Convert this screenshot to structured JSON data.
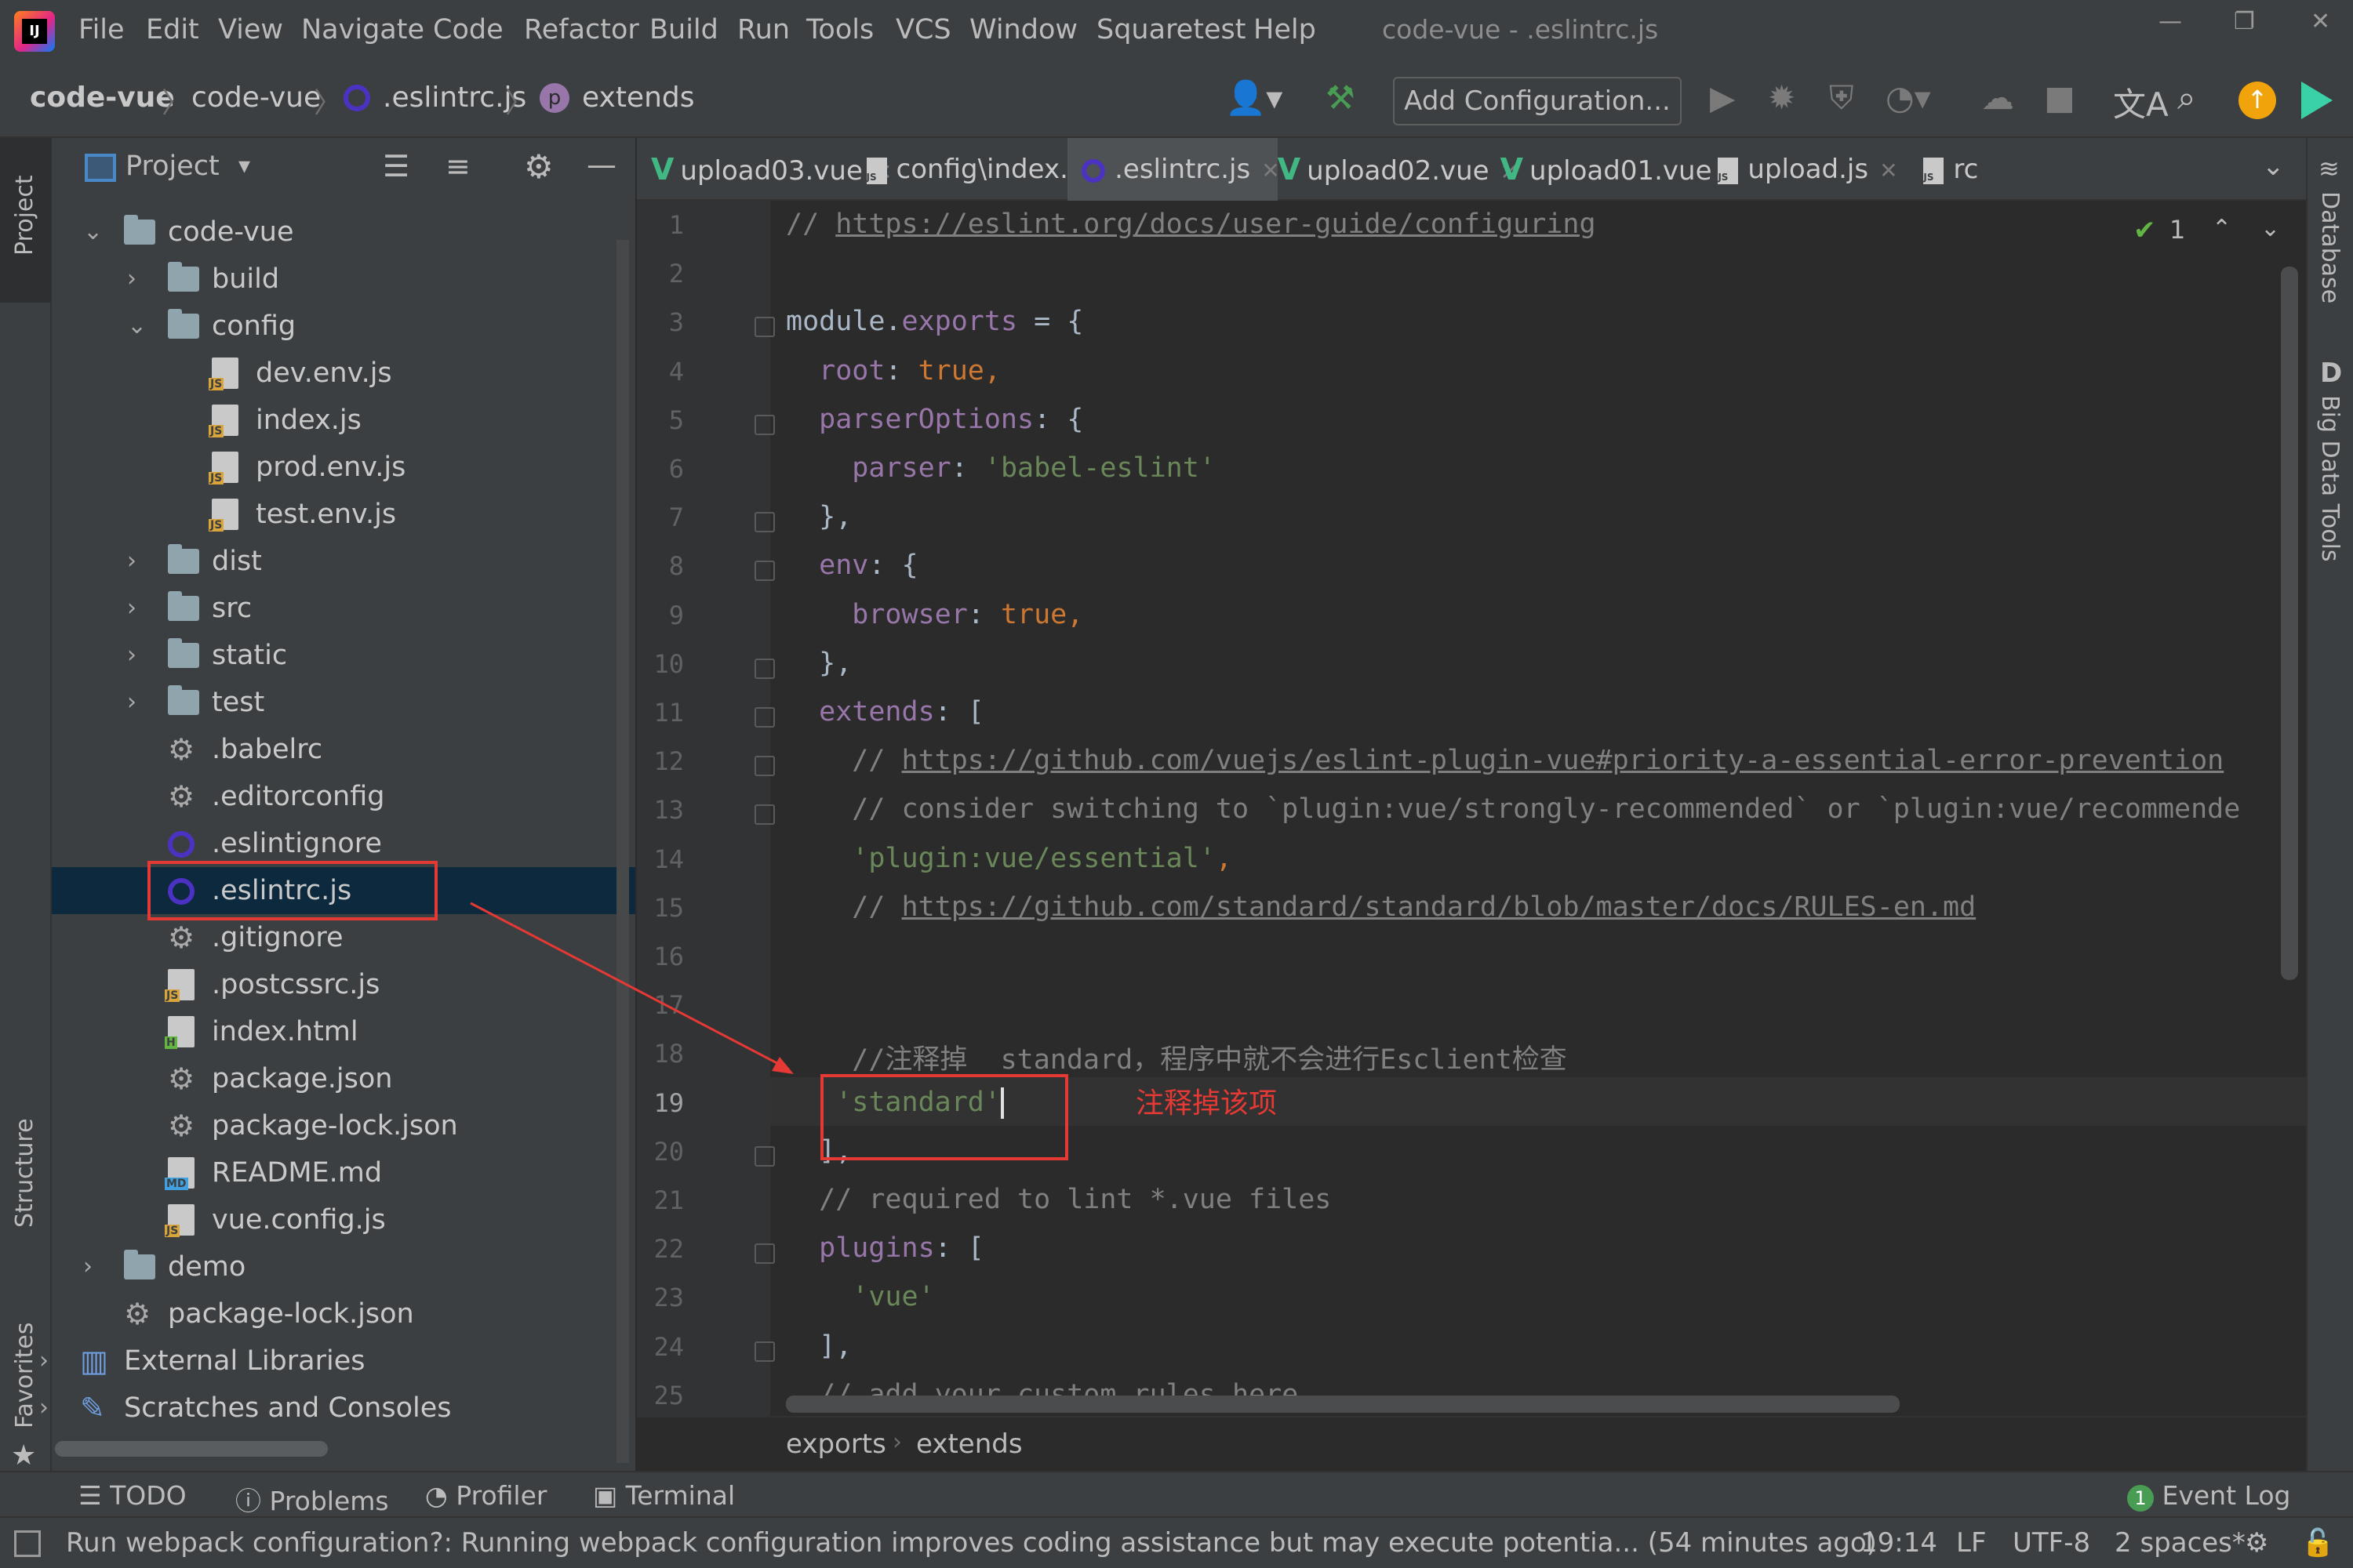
{
  "menubar": {
    "items": [
      "File",
      "Edit",
      "View",
      "Navigate",
      "Code",
      "Refactor",
      "Build",
      "Run",
      "Tools",
      "VCS",
      "Window",
      "Squaretest",
      "Help"
    ],
    "window_title": "code-vue - .eslintrc.js"
  },
  "navbar": {
    "crumbs": [
      "code-vue",
      "code-vue",
      ".eslintrc.js",
      "extends"
    ],
    "add_config_label": "Add Configuration..."
  },
  "left_strip": {
    "project": "Project",
    "structure": "Structure",
    "favorites": "Favorites"
  },
  "right_strip": {
    "database": "Database",
    "big_data": "Big Data Tools"
  },
  "project_panel": {
    "title": "Project",
    "tree": [
      {
        "label": "code-vue",
        "type": "folder",
        "expanded": true
      },
      {
        "label": "build",
        "type": "folder",
        "expanded": false
      },
      {
        "label": "config",
        "type": "folder",
        "expanded": true
      },
      {
        "label": "dev.env.js",
        "type": "js"
      },
      {
        "label": "index.js",
        "type": "js"
      },
      {
        "label": "prod.env.js",
        "type": "js"
      },
      {
        "label": "test.env.js",
        "type": "js"
      },
      {
        "label": "dist",
        "type": "folder",
        "expanded": false
      },
      {
        "label": "src",
        "type": "folder",
        "expanded": false
      },
      {
        "label": "static",
        "type": "folder",
        "expanded": false
      },
      {
        "label": "test",
        "type": "folder",
        "expanded": false
      },
      {
        "label": ".babelrc",
        "type": "config"
      },
      {
        "label": ".editorconfig",
        "type": "gear"
      },
      {
        "label": ".eslintignore",
        "type": "eslint"
      },
      {
        "label": ".eslintrc.js",
        "type": "eslint",
        "selected": true
      },
      {
        "label": ".gitignore",
        "type": "config"
      },
      {
        "label": ".postcssrc.js",
        "type": "js"
      },
      {
        "label": "index.html",
        "type": "html"
      },
      {
        "label": "package.json",
        "type": "config"
      },
      {
        "label": "package-lock.json",
        "type": "config"
      },
      {
        "label": "README.md",
        "type": "md"
      },
      {
        "label": "vue.config.js",
        "type": "js"
      },
      {
        "label": "demo",
        "type": "folder",
        "expanded": false
      },
      {
        "label": "package-lock.json",
        "type": "config"
      },
      {
        "label": "External Libraries",
        "type": "lib"
      },
      {
        "label": "Scratches and Consoles",
        "type": "scratch"
      }
    ]
  },
  "tabs": [
    {
      "label": "upload03.vue",
      "icon": "vue-icon"
    },
    {
      "label": "config\\index.js",
      "icon": "js-icon"
    },
    {
      "label": ".eslintrc.js",
      "icon": "eslint-icon",
      "active": true
    },
    {
      "label": "upload02.vue",
      "icon": "vue-icon"
    },
    {
      "label": "upload01.vue",
      "icon": "vue-icon"
    },
    {
      "label": "upload.js",
      "icon": "js-icon"
    },
    {
      "label": "rc",
      "icon": "js-icon"
    }
  ],
  "editor": {
    "inspection_count": "1",
    "line_numbers": [
      "1",
      "2",
      "3",
      "4",
      "5",
      "6",
      "7",
      "8",
      "9",
      "10",
      "11",
      "12",
      "13",
      "14",
      "15",
      "16",
      "17",
      "18",
      "19",
      "20",
      "21",
      "22",
      "23",
      "24",
      "25"
    ],
    "lines": [
      [
        {
          "t": "// ",
          "c": "cmt"
        },
        {
          "t": "https://eslint.org/docs/user-guide/configuring",
          "c": "url"
        }
      ],
      [],
      [
        {
          "t": "module.",
          "c": ""
        },
        {
          "t": "exports",
          "c": "prop"
        },
        {
          "t": " = {",
          "c": ""
        }
      ],
      [
        {
          "t": "  root",
          "c": "prop"
        },
        {
          "t": ": ",
          "c": ""
        },
        {
          "t": "true",
          "c": "kw"
        },
        {
          "t": ",",
          "c": "kw"
        }
      ],
      [
        {
          "t": "  parserOptions",
          "c": "prop"
        },
        {
          "t": ": {",
          "c": ""
        }
      ],
      [
        {
          "t": "    parser",
          "c": "prop"
        },
        {
          "t": ": ",
          "c": ""
        },
        {
          "t": "'babel-eslint'",
          "c": "str"
        }
      ],
      [
        {
          "t": "  },",
          "c": ""
        }
      ],
      [
        {
          "t": "  env",
          "c": "prop"
        },
        {
          "t": ": {",
          "c": ""
        }
      ],
      [
        {
          "t": "    browser",
          "c": "prop"
        },
        {
          "t": ": ",
          "c": ""
        },
        {
          "t": "true",
          "c": "kw"
        },
        {
          "t": ",",
          "c": "kw"
        }
      ],
      [
        {
          "t": "  },",
          "c": ""
        }
      ],
      [
        {
          "t": "  extends",
          "c": "prop"
        },
        {
          "t": ": [",
          "c": ""
        }
      ],
      [
        {
          "t": "    // ",
          "c": "cmt"
        },
        {
          "t": "https://github.com/vuejs/eslint-plugin-vue#priority-a-essential-error-prevention",
          "c": "url"
        }
      ],
      [
        {
          "t": "    // consider switching to `plugin:vue/strongly-recommended` or `plugin:vue/recommende",
          "c": "cmt"
        }
      ],
      [
        {
          "t": "    'plugin:vue/essential'",
          "c": "str"
        },
        {
          "t": ",",
          "c": "kw"
        }
      ],
      [
        {
          "t": "    // ",
          "c": "cmt"
        },
        {
          "t": "https://github.com/standard/standard/blob/master/docs/RULES-en.md",
          "c": "url"
        }
      ],
      [],
      [],
      [
        {
          "t": "    //注释掉  standard，程序中就不会进行Esclient检查",
          "c": "cmt"
        }
      ],
      [
        {
          "t": "   'standard'",
          "c": "str"
        }
      ],
      [
        {
          "t": "  ],",
          "c": ""
        }
      ],
      [
        {
          "t": "  // required to lint *.vue files",
          "c": "cmt"
        }
      ],
      [
        {
          "t": "  plugins",
          "c": "prop"
        },
        {
          "t": ": [",
          "c": ""
        }
      ],
      [
        {
          "t": "    'vue'",
          "c": "str"
        }
      ],
      [
        {
          "t": "  ],",
          "c": ""
        }
      ],
      [
        {
          "t": "  // add your custom rules here",
          "c": "cmt"
        }
      ]
    ],
    "breadcrumb": [
      "exports",
      "extends"
    ]
  },
  "annotation": {
    "text": "注释掉该项"
  },
  "bottom_tools": [
    "TODO",
    "Problems",
    "Profiler",
    "Terminal"
  ],
  "event_log": {
    "count": "1",
    "label": "Event Log"
  },
  "status": {
    "message": "Run webpack configuration?: Running webpack configuration improves coding assistance but may execute potentia... (54 minutes ago)",
    "position": "19:14",
    "line_sep": "LF",
    "encoding": "UTF-8",
    "indent": "2 spaces*"
  }
}
